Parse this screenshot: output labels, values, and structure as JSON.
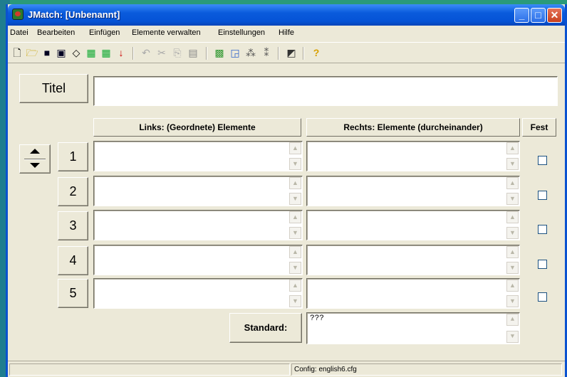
{
  "window": {
    "title": "JMatch: [Unbenannt]"
  },
  "menu": [
    "Datei",
    "Bearbeiten",
    "Einfügen",
    "Elemente verwalten",
    "Einstellungen",
    "Hilfe"
  ],
  "title_button_label": "Titel",
  "headers": {
    "left": "Links: (Geordnete) Elemente",
    "right": "Rechts: Elemente (durcheinander)",
    "fixed": "Fest"
  },
  "rows": [
    {
      "num": "1"
    },
    {
      "num": "2"
    },
    {
      "num": "3"
    },
    {
      "num": "4"
    },
    {
      "num": "5"
    }
  ],
  "standard": {
    "label": "Standard:",
    "value": "???"
  },
  "status": {
    "config": "Config: english6.cfg"
  }
}
